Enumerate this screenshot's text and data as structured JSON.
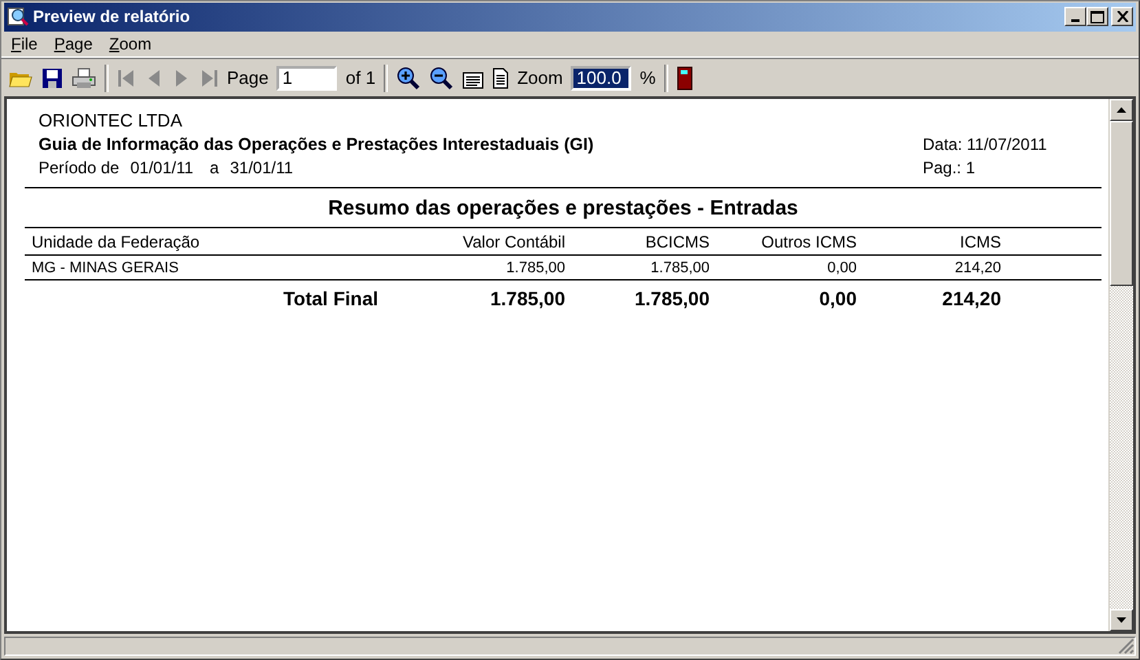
{
  "window": {
    "title": "Preview de relatório"
  },
  "menu": [
    {
      "label": "File"
    },
    {
      "label": "Page"
    },
    {
      "label": "Zoom"
    }
  ],
  "toolbar": {
    "page_label": "Page",
    "page_value": "1",
    "page_of": "of 1",
    "zoom_label": "Zoom",
    "zoom_value": "100.0",
    "zoom_unit": "%"
  },
  "report": {
    "company": "ORIONTEC  LTDA",
    "title": "Guia de Informação das Operações e Prestações Interestaduais (GI)",
    "period_label": "Período de",
    "period_from": "01/01/11",
    "period_sep": "a",
    "period_to": "31/01/11",
    "date": "Data: 11/07/2011",
    "page": "Pag.: 1",
    "section": "Resumo das operações e prestações - Entradas",
    "columns": [
      "Unidade da Federação",
      "Valor Contábil",
      "BCICMS",
      "Outros ICMS",
      "ICMS"
    ],
    "rows": [
      [
        "MG  -  MINAS GERAIS",
        "1.785,00",
        "1.785,00",
        "0,00",
        "214,20"
      ]
    ],
    "total": [
      "Total Final",
      "1.785,00",
      "1.785,00",
      "0,00",
      "214,20"
    ]
  }
}
